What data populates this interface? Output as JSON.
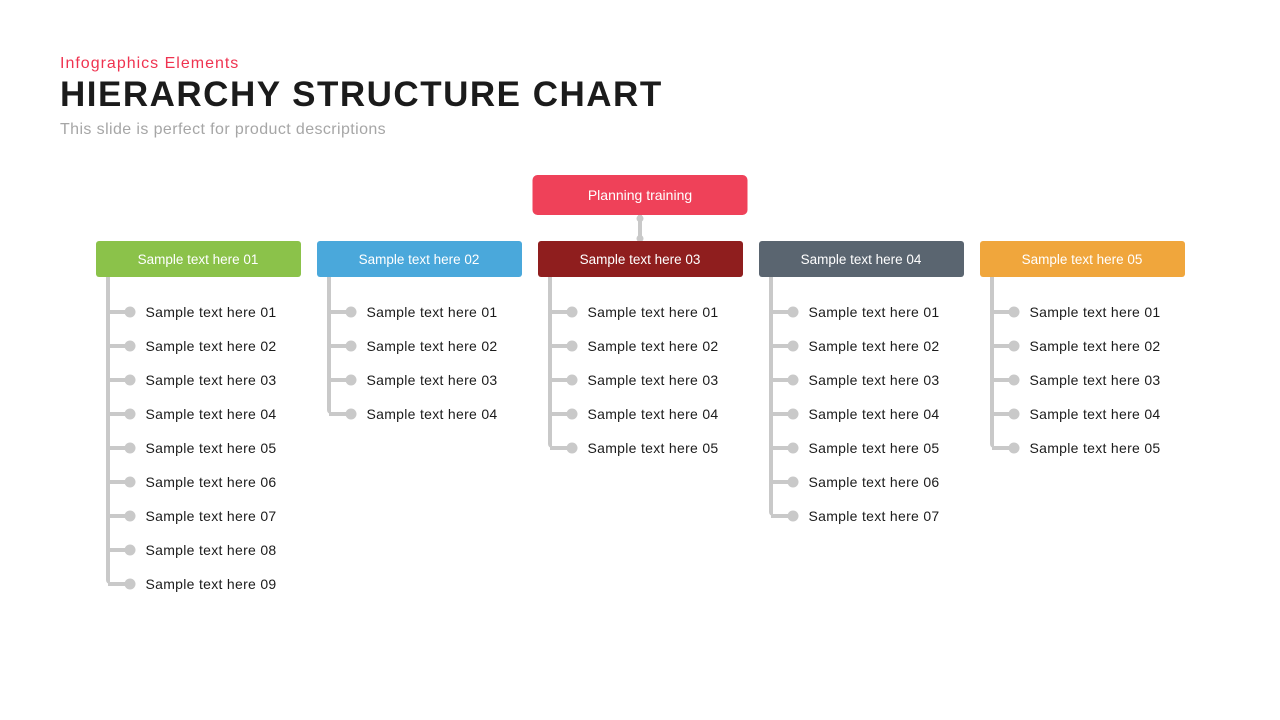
{
  "header": {
    "pretitle": "Infographics Elements",
    "title": "HIERARCHY STRUCTURE CHART",
    "subtitle": "This slide is perfect for product descriptions"
  },
  "root": {
    "label": "Planning training",
    "color": "#ef4159"
  },
  "columns": [
    {
      "header": "Sample text here 01",
      "color": "#8bc24a",
      "items": [
        "Sample text here 01",
        "Sample text here 02",
        "Sample text here 03",
        "Sample text here 04",
        "Sample text here 05",
        "Sample text here 06",
        "Sample text here 07",
        "Sample text here 08",
        "Sample text here 09"
      ]
    },
    {
      "header": "Sample text here 02",
      "color": "#4aa8db",
      "items": [
        "Sample text here 01",
        "Sample text here 02",
        "Sample text here 03",
        "Sample text here 04"
      ]
    },
    {
      "header": "Sample text here 03",
      "color": "#8f1e1e",
      "items": [
        "Sample text here 01",
        "Sample text here 02",
        "Sample text here 03",
        "Sample text here 04",
        "Sample text here 05"
      ]
    },
    {
      "header": "Sample text here 04",
      "color": "#5a6570",
      "items": [
        "Sample text here 01",
        "Sample text here 02",
        "Sample text here 03",
        "Sample text here 04",
        "Sample text here 05",
        "Sample text here 06",
        "Sample text here 07"
      ]
    },
    {
      "header": "Sample text here 05",
      "color": "#f0a63c",
      "items": [
        "Sample text here 01",
        "Sample text here 02",
        "Sample text here 03",
        "Sample text here 04",
        "Sample text here 05"
      ]
    }
  ]
}
